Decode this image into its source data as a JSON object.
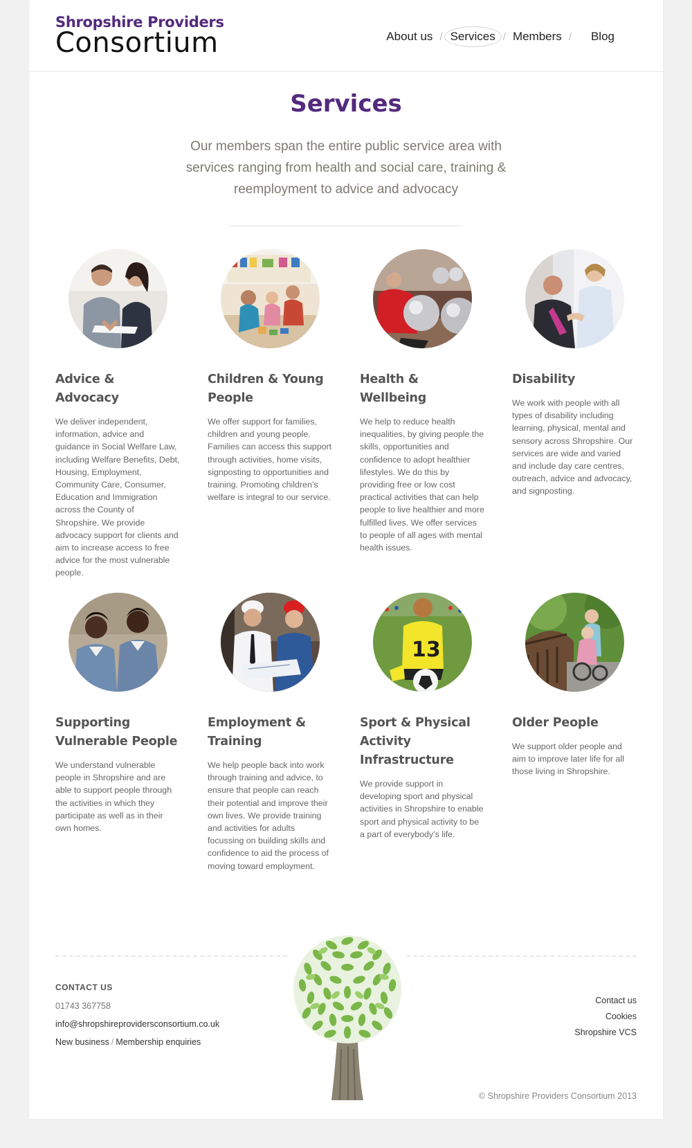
{
  "header": {
    "logo_top": "Shropshire Providers",
    "logo_bottom": "Consortium",
    "nav": [
      {
        "label": "About us"
      },
      {
        "label": "Services"
      },
      {
        "label": "Members"
      },
      {
        "label": "Blog"
      }
    ],
    "nav_separator": "/"
  },
  "intro": {
    "title": "Services",
    "text": "Our members span the entire public service area with services ranging from health and social care, training & reemployment to advice and advocacy"
  },
  "services": [
    {
      "title": "Advice & Advocacy",
      "image": "advice-photo",
      "text": "We deliver independent, information, advice and guidance in Social Welfare Law, including Welfare Benefits, Debt, Housing, Employment, Community Care, Consumer, Education and Immigration across the County of Shropshire. We provide advocacy support for clients and aim to increase access to free advice for the most vulnerable people."
    },
    {
      "title": "Children & Young People",
      "image": "children-photo",
      "text": "We offer support for families, children and young people. Families can access this support through activities, home visits, signposting to opportunities and training. Promoting children’s welfare is integral to our service."
    },
    {
      "title": "Health & Wellbeing",
      "image": "health-photo",
      "text": "We help to reduce health inequalities, by giving people the skills, opportunities and confidence to adopt healthier lifestyles. We do this by providing free or low cost practical activities that can help people to live healthier and more fulfilled lives. We offer services to people of all ages with mental health issues."
    },
    {
      "title": "Disability",
      "image": "disability-photo",
      "text": "We work with people with all types of disability including learning, physical, mental and sensory across Shropshire. Our services are wide and varied and include day care centres, outreach, advice and advocacy, and signposting."
    },
    {
      "title": "Supporting Vulnerable People",
      "image": "vulnerable-photo",
      "text": "We understand vulnerable people in Shropshire and are able to support people through the activities in which they participate as well as in their own homes."
    },
    {
      "title": "Employment & Training",
      "image": "employment-photo",
      "text": "We help people back into work through training and advice, to ensure that people can reach their potential and improve their own lives. We provide training and activities for adults focussing on building skills and confidence to aid the process of moving toward employment."
    },
    {
      "title": "Sport & Physical Activity Infrastructure",
      "image": "sport-photo",
      "text": "We provide support in developing sport and physical activities in Shropshire to enable sport and physical activity to be a part of everybody’s life."
    },
    {
      "title": "Older People",
      "image": "older-people-photo",
      "text": "We support older people and aim to improve later life for all those living in Shropshire."
    }
  ],
  "footer": {
    "contact_heading": "CONTACT US",
    "phone": "01743 367758",
    "email": "info@shropshireprovidersconsortium.co.uk",
    "new_business": "New business",
    "slash": "/",
    "membership": "Membership enquiries",
    "links": [
      "Contact us",
      "Cookies",
      "Shropshire VCS"
    ],
    "copyright": "© Shropshire Providers Consortium 2013"
  },
  "colors": {
    "brand_purple": "#532a7d",
    "tree_green": "#7ab648",
    "tree_trunk": "#8c8472",
    "background": "#f1f1f1"
  }
}
